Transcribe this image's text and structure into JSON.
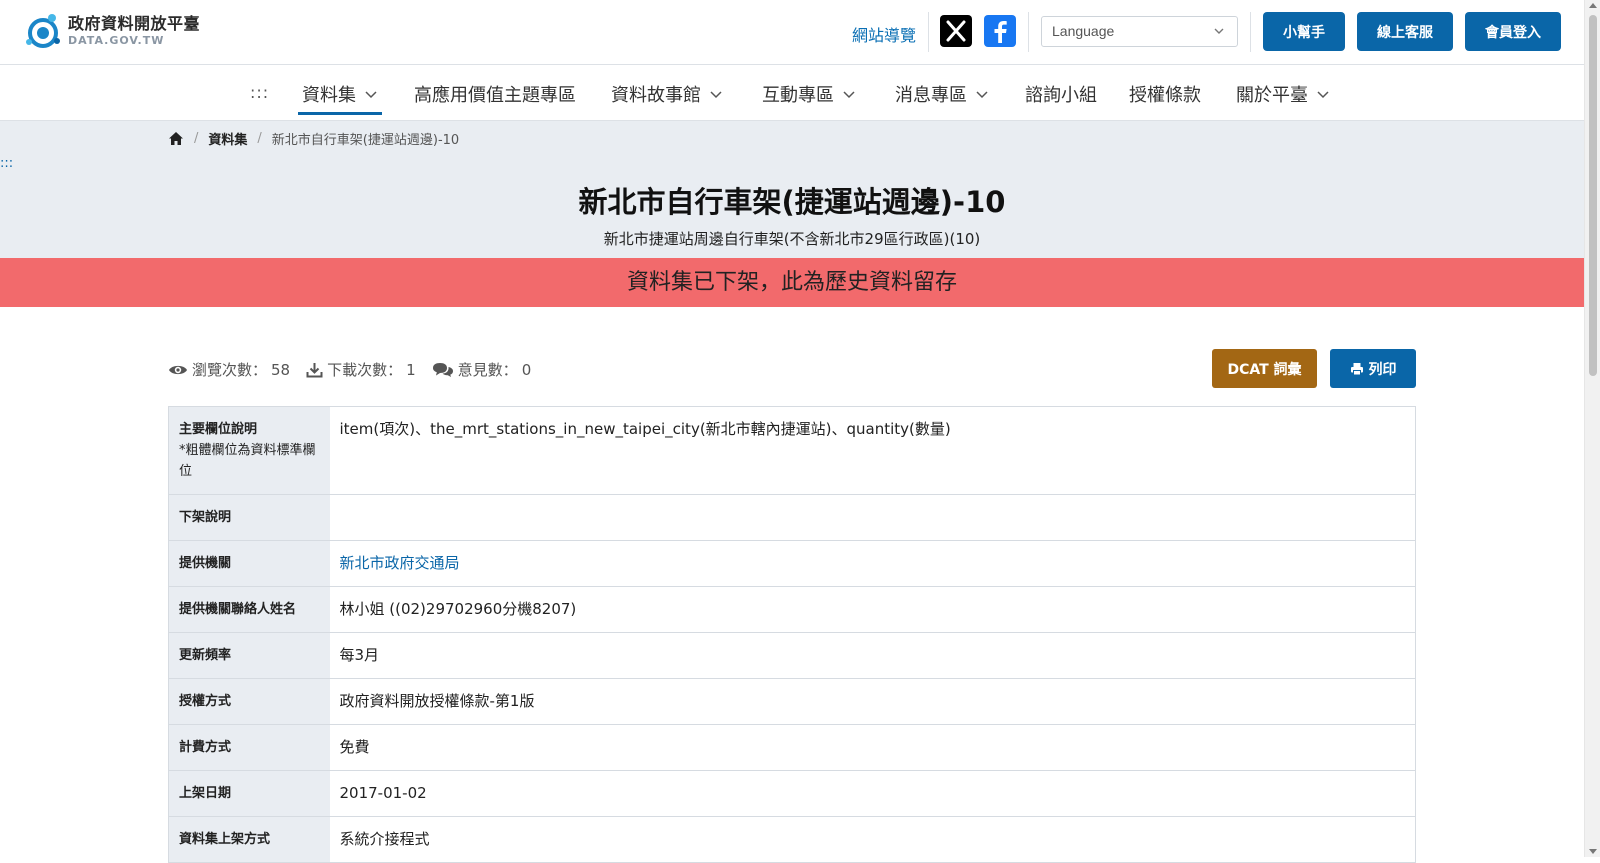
{
  "header": {
    "logo_cn": "政府資料開放平臺",
    "logo_en": "DATA.GOV.TW",
    "sitemap_label": "網站導覽",
    "language_placeholder": "Language",
    "helper_label": "小幫手",
    "support_label": "線上客服",
    "login_label": "會員登入",
    "social": [
      "x-icon",
      "facebook-icon"
    ]
  },
  "nav": {
    "accesskey": ":::",
    "items": [
      {
        "label": "資料集",
        "has_dropdown": true,
        "active": true
      },
      {
        "label": "高應用價值主題專區",
        "has_dropdown": false
      },
      {
        "label": "資料故事館",
        "has_dropdown": true
      },
      {
        "label": "互動專區",
        "has_dropdown": true
      },
      {
        "label": "消息專區",
        "has_dropdown": true
      },
      {
        "label": "諮詢小組",
        "has_dropdown": false
      },
      {
        "label": "授權條款",
        "has_dropdown": false
      },
      {
        "label": "關於平臺",
        "has_dropdown": true
      }
    ]
  },
  "breadcrumb": {
    "home_icon": "home-icon",
    "items": [
      "資料集",
      "新北市自行車架(捷運站週邊)-10"
    ]
  },
  "side_accesskey": ":::",
  "dataset": {
    "title": "新北市自行車架(捷運站週邊)-10",
    "subtitle": "新北市捷運站周邊自行車架(不含新北市29區行政區)(10)",
    "banner": "資料集已下架，此為歷史資料留存"
  },
  "stats": {
    "views_label": "瀏覽次數：",
    "views": "58",
    "downloads_label": "下載次數：",
    "downloads": "1",
    "comments_label": "意見數：",
    "comments": "0"
  },
  "actions": {
    "dcat_label": "DCAT 詞彙",
    "print_label": "列印"
  },
  "table": {
    "rows": [
      {
        "label": "主要欄位說明",
        "note": "*粗體欄位為資料標準欄位",
        "value": "item(項次)、the_mrt_stations_in_new_taipei_city(新北市轄內捷運站)、quantity(數量)"
      },
      {
        "label": "下架說明",
        "value": ""
      },
      {
        "label": "提供機關",
        "value": "新北市政府交通局",
        "link": true
      },
      {
        "label": "提供機關聯絡人姓名",
        "value": "林小姐 ((02)29702960分機8207)"
      },
      {
        "label": "更新頻率",
        "value": "每3月"
      },
      {
        "label": "授權方式",
        "value": "政府資料開放授權條款-第1版"
      },
      {
        "label": "計費方式",
        "value": "免費"
      },
      {
        "label": "上架日期",
        "value": "2017-01-02"
      },
      {
        "label": "資料集上架方式",
        "value": "系統介接程式"
      }
    ]
  },
  "colors": {
    "primary": "#0a66a8",
    "banner": "#f26a6c",
    "dcat": "#a36714",
    "hero_bg": "#e9edf2"
  }
}
